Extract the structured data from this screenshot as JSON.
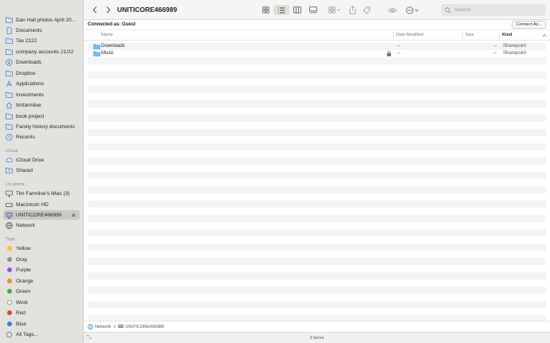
{
  "sidebar": {
    "favorites": [
      {
        "label": "Dan Hall photos April 20...",
        "icon": "folder-icon"
      },
      {
        "label": "Documents",
        "icon": "folder-icon"
      },
      {
        "label": "Tax 2122",
        "icon": "folder-icon"
      },
      {
        "label": "company accounts 21/22",
        "icon": "folder-icon"
      },
      {
        "label": "Downloads",
        "icon": "download-icon"
      },
      {
        "label": "Dropbox",
        "icon": "folder-icon"
      },
      {
        "label": "Applications",
        "icon": "applications-icon"
      },
      {
        "label": "Investments",
        "icon": "folder-icon"
      },
      {
        "label": "timfarmiloe",
        "icon": "home-icon"
      },
      {
        "label": "book project",
        "icon": "folder-icon"
      },
      {
        "label": "Family history documents",
        "icon": "folder-icon"
      },
      {
        "label": "Recents",
        "icon": "clock-icon"
      }
    ],
    "icloud_header": "iCloud",
    "icloud": [
      {
        "label": "iCloud Drive",
        "icon": "cloud-icon"
      },
      {
        "label": "Shared",
        "icon": "shared-folder-icon"
      }
    ],
    "locations_header": "Locations",
    "locations": [
      {
        "label": "Tim Farmiloe's iMac (3)",
        "icon": "imac-icon"
      },
      {
        "label": "Macintosh HD",
        "icon": "disk-icon"
      },
      {
        "label": "UNITICORE466989",
        "icon": "server-icon"
      },
      {
        "label": "Network",
        "icon": "globe-icon"
      }
    ],
    "tags_header": "Tags",
    "tags": [
      {
        "label": "Yellow",
        "color": "#f5c518"
      },
      {
        "label": "Gray",
        "color": "#8e8e8e"
      },
      {
        "label": "Purple",
        "color": "#a550d1"
      },
      {
        "label": "Orange",
        "color": "#f08a24"
      },
      {
        "label": "Green",
        "color": "#3cb043"
      },
      {
        "label": "Work",
        "color": "#ffffff"
      },
      {
        "label": "Red",
        "color": "#e0413a"
      },
      {
        "label": "Blue",
        "color": "#2f7de1"
      },
      {
        "label": "All Tags...",
        "color": ""
      }
    ]
  },
  "toolbar": {
    "title": "UNITICORE466989",
    "search_placeholder": "Search"
  },
  "connect_bar": {
    "text": "Connected as: Guest",
    "button": "Connect As..."
  },
  "columns": {
    "name": "Name",
    "date_modified": "Date Modified",
    "size": "Size",
    "kind": "Kind"
  },
  "files": [
    {
      "name": "Downloads",
      "date": "--",
      "size": "--",
      "kind": "Sharepoint",
      "locked": false
    },
    {
      "name": "Music",
      "date": "--",
      "size": "--",
      "kind": "Sharepoint",
      "locked": true
    }
  ],
  "pathbar": {
    "root": "Network",
    "separator": ">",
    "current": "UNITICORE466989"
  },
  "status": {
    "item_count": "2 items"
  },
  "colors": {
    "folder": "#5aaee8",
    "accent": "#2f7de1",
    "sidebar_bg": "#e3e2df"
  }
}
